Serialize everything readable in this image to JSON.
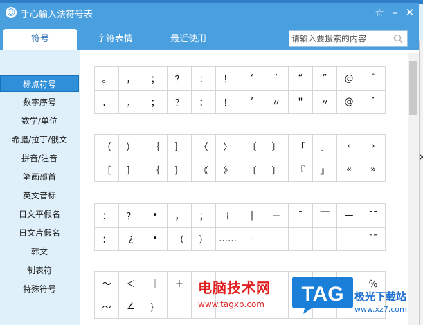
{
  "window": {
    "title": "手心输入法符号表"
  },
  "tabs": [
    {
      "label": "符号",
      "active": true
    },
    {
      "label": "字符表情",
      "active": false
    },
    {
      "label": "最近使用",
      "active": false
    }
  ],
  "search": {
    "placeholder": "请输入要搜索的内容"
  },
  "categories": [
    {
      "label": "标点符号",
      "active": true
    },
    {
      "label": "数字序号"
    },
    {
      "label": "数学/单位"
    },
    {
      "label": "希腊/拉丁/俄文"
    },
    {
      "label": "拼音/注音"
    },
    {
      "label": "笔画部首"
    },
    {
      "label": "英文音标"
    },
    {
      "label": "日文平假名"
    },
    {
      "label": "日文片假名"
    },
    {
      "label": "韩文"
    },
    {
      "label": "制表符"
    },
    {
      "label": "特殊符号"
    }
  ],
  "symbol_groups": [
    {
      "rows": [
        [
          "。",
          "，",
          "；",
          "？",
          "：",
          "！",
          "‘",
          "’",
          "“",
          "”",
          "＠",
          "＾"
        ],
        [
          "．",
          "，",
          "；",
          "？",
          "：",
          "！",
          "’",
          "〃",
          "＂",
          "〃",
          "@",
          "ˇ"
        ]
      ]
    },
    {
      "rows": [
        [
          "（",
          "）",
          "｛",
          "｝",
          "〈",
          "〉",
          "〔",
          "〕",
          "「",
          "」",
          "‹",
          "›"
        ],
        [
          "［",
          "］",
          "｛",
          "｝",
          "《",
          "》",
          "〔",
          "〕",
          "『",
          "』",
          "«",
          "»"
        ]
      ]
    },
    {
      "rows": [
        [
          "：",
          "？",
          "•",
          "，",
          "；",
          "¡",
          "‖",
          "－",
          "¯",
          "￣",
          "—",
          "¯¯"
        ],
        [
          "：",
          "¿",
          "•",
          "（",
          "）",
          "……",
          "-",
          "—",
          "_",
          "__",
          "—",
          "˜˜"
        ]
      ]
    },
    {
      "rows": [
        [
          "～",
          "＜",
          "｜",
          "＋",
          "",
          "",
          "",
          "",
          "",
          "",
          "",
          "％"
        ],
        [
          "～",
          "∠",
          "｝",
          "",
          "",
          "",
          "",
          "",
          "",
          "",
          "",
          ""
        ]
      ]
    }
  ],
  "watermarks": {
    "left_title": "电脑技术网",
    "left_url": "www.tagxp.com",
    "tag_text": "TAG",
    "right_title": "极光下载站",
    "right_url": "www.xz7.com"
  },
  "colors": {
    "title_bar": "#4a9fde",
    "active_category": "#2f8fd8",
    "sidebar_bg": "#dff0fb",
    "watermark_red": "#e02020",
    "watermark_blue": "#1c6fd0"
  }
}
